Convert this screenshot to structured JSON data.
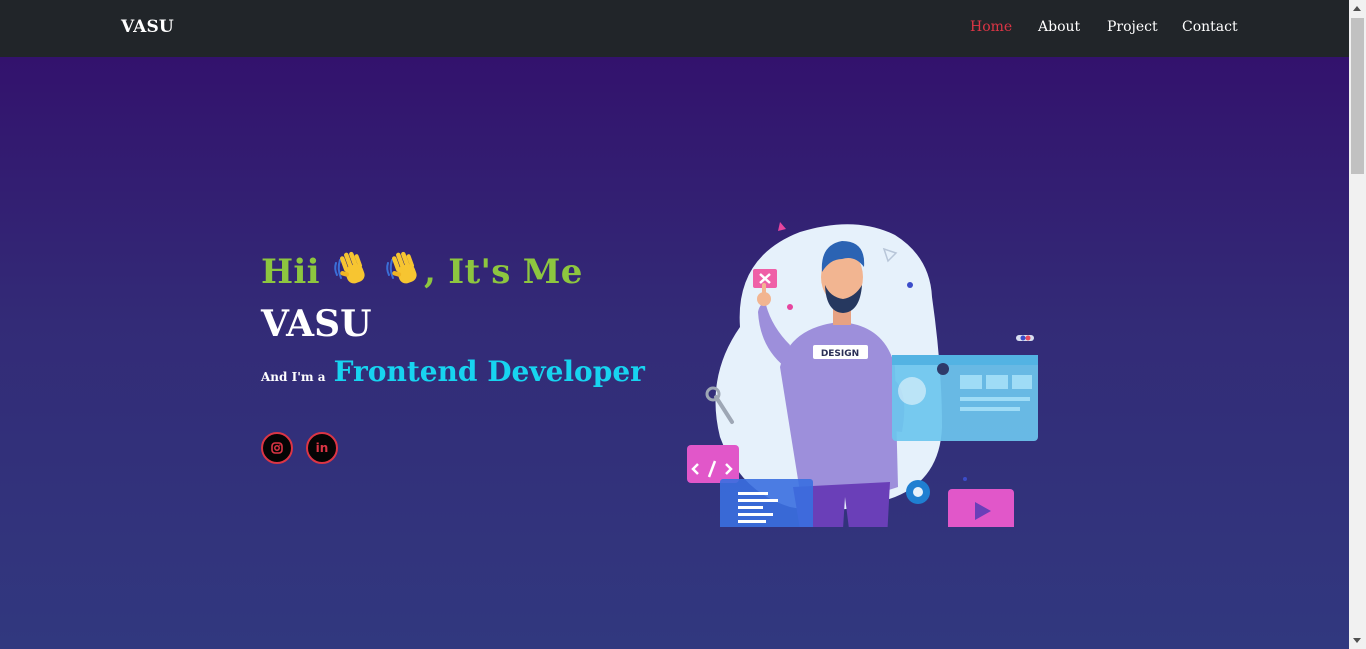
{
  "navbar": {
    "brand": "VASU",
    "links": [
      {
        "label": "Home",
        "active": true
      },
      {
        "label": "About",
        "active": false
      },
      {
        "label": "Project",
        "active": false
      },
      {
        "label": "Contact",
        "active": false
      }
    ]
  },
  "hero": {
    "greeting_start": "Hii ",
    "greeting_end": ", It's Me",
    "greeting_icons": [
      "waving-hand-icon",
      "waving-hand-icon"
    ],
    "name": "VASU",
    "role_prefix": "And I'm a",
    "role_title": "Frontend Developer",
    "illustration_badge": "DESIGN",
    "social_links": [
      {
        "icon": "instagram-icon"
      },
      {
        "icon": "linkedin-icon",
        "glyph": "in"
      }
    ]
  },
  "colors": {
    "navbar_bg": "#212529",
    "accent_red": "#dc3545",
    "greeting_green": "#8dc63f",
    "role_cyan": "#17d4f0",
    "hero_top": "#33126d",
    "hero_bottom": "#31387f"
  }
}
